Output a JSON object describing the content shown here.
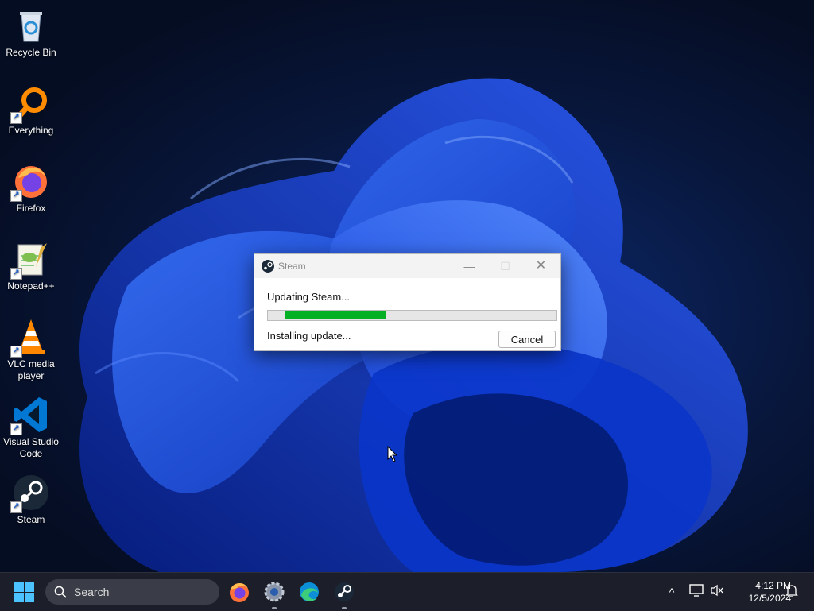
{
  "desktop": {
    "icons": [
      {
        "label": "Recycle Bin",
        "icon": "recycle-bin-icon",
        "shortcut": false
      },
      {
        "label": "Everything",
        "icon": "everything-search-icon",
        "shortcut": true
      },
      {
        "label": "Firefox",
        "icon": "firefox-icon",
        "shortcut": true
      },
      {
        "label": "Notepad++",
        "icon": "notepadpp-icon",
        "shortcut": true
      },
      {
        "label": "VLC media player",
        "icon": "vlc-icon",
        "shortcut": true
      },
      {
        "label": "Visual Studio Code",
        "icon": "vscode-icon",
        "shortcut": true
      },
      {
        "label": "Steam",
        "icon": "steam-icon",
        "shortcut": true
      }
    ]
  },
  "dialog": {
    "title": "Steam",
    "status": "Updating Steam...",
    "substatus": "Installing update...",
    "cancel_label": "Cancel",
    "progress_fraction": 0.35,
    "controls": {
      "minimize": "—",
      "maximize": "☐",
      "close": "✕"
    }
  },
  "taskbar": {
    "search_label": "Search",
    "pinned": [
      "firefox-icon",
      "settings-icon",
      "edge-icon",
      "steam-icon"
    ],
    "clock": {
      "time": "4:12 PM",
      "date": "12/5/2024"
    },
    "tray_icons": [
      "chevron-up-icon",
      "network-icon",
      "volume-muted-icon",
      "notification-bell-icon"
    ]
  },
  "colors": {
    "accent": "#4cc2ff",
    "progress": "#06b025",
    "taskbar": "#1c1f29"
  }
}
